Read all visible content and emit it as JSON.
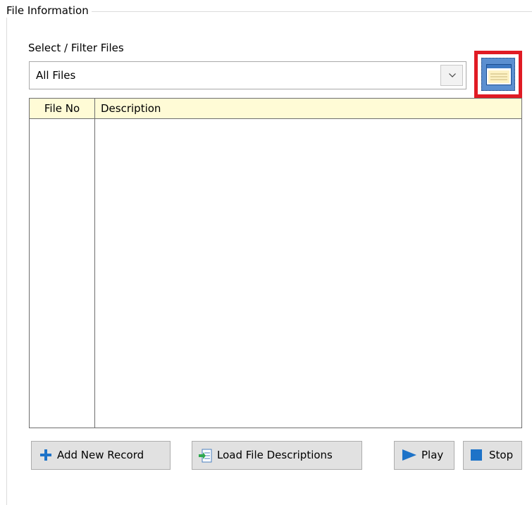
{
  "group": {
    "title": "File Information"
  },
  "filter": {
    "label": "Select / Filter Files",
    "selected": "All Files"
  },
  "grid": {
    "columns": [
      "File No",
      "Description"
    ],
    "rows": []
  },
  "buttons": {
    "add_record": "Add New Record",
    "load_descriptions": "Load File Descriptions",
    "play": "Play",
    "stop": "Stop"
  },
  "highlight": {
    "target": "browse-button",
    "color": "#e01b24"
  },
  "icons": {
    "browse": "window-icon",
    "dropdown": "chevron-down-icon",
    "add": "plus-icon",
    "load": "import-icon",
    "play": "play-icon",
    "stop": "stop-icon"
  }
}
